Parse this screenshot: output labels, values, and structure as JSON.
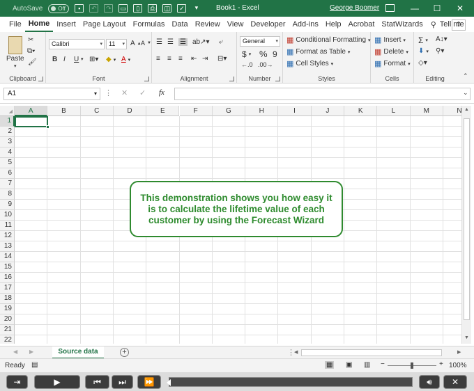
{
  "title_bar": {
    "autosave_label": "AutoSave",
    "autosave_state": "Off",
    "window_title": "Book1  -  Excel",
    "user_name": "George Boomer"
  },
  "tabs": [
    "File",
    "Home",
    "Insert",
    "Page Layout",
    "Formulas",
    "Data",
    "Review",
    "View",
    "Developer",
    "Add-ins",
    "Help",
    "Acrobat",
    "StatWizards"
  ],
  "active_tab": "Home",
  "tell_me": "Tell me",
  "ribbon": {
    "clipboard": {
      "label": "Clipboard",
      "paste": "Paste"
    },
    "font": {
      "label": "Font",
      "font_name": "Calibri",
      "font_size": "11",
      "bold": "B",
      "italic": "I",
      "underline": "U"
    },
    "alignment": {
      "label": "Alignment"
    },
    "number": {
      "label": "Number",
      "format": "General",
      "currency": "$",
      "percent": "%",
      "comma": "9"
    },
    "styles": {
      "label": "Styles",
      "conditional": "Conditional Formatting",
      "format_table": "Format as Table",
      "cell_styles": "Cell Styles"
    },
    "cells": {
      "label": "Cells",
      "insert": "Insert",
      "delete": "Delete",
      "format": "Format"
    },
    "editing": {
      "label": "Editing"
    }
  },
  "formula_bar": {
    "name_box": "A1",
    "fx": "fx",
    "formula": ""
  },
  "columns": [
    "A",
    "B",
    "C",
    "D",
    "E",
    "F",
    "G",
    "H",
    "I",
    "J",
    "K",
    "L",
    "M",
    "N"
  ],
  "rows": [
    "1",
    "2",
    "3",
    "4",
    "5",
    "6",
    "7",
    "8",
    "9",
    "10",
    "11",
    "12",
    "13",
    "14",
    "15",
    "16",
    "17",
    "18",
    "19",
    "20",
    "21",
    "22"
  ],
  "callout": "This demonstration shows you how easy it is to calculate the lifetime value of each customer by using the Forecast Wizard",
  "sheet_tab": "Source data",
  "status": {
    "ready": "Ready",
    "zoom": "100%"
  },
  "colors": {
    "excel_green": "#217346",
    "callout_green": "#2e8b2e"
  }
}
